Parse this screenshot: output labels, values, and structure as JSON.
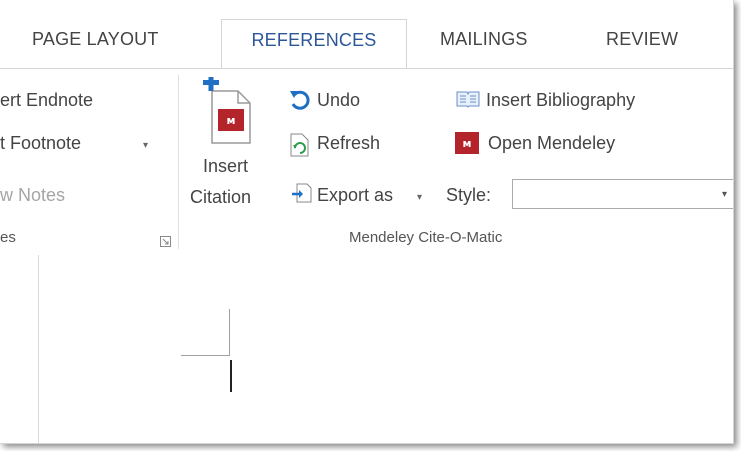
{
  "tabs": [
    {
      "label": "PAGE LAYOUT",
      "active": false
    },
    {
      "label": "REFERENCES",
      "active": true
    },
    {
      "label": "MAILINGS",
      "active": false
    },
    {
      "label": "REVIEW",
      "active": false
    }
  ],
  "footnotes_group": {
    "insert_endnote": "ert Endnote",
    "insert_footnote": "t Footnote",
    "show_notes": "w Notes",
    "label": "es"
  },
  "mendeley": {
    "insert_citation_line1": "Insert",
    "insert_citation_line2": "Citation",
    "undo": "Undo",
    "refresh": "Refresh",
    "export_as": "Export as",
    "style_label": "Style:",
    "style_value": "",
    "insert_bibliography": "Insert Bibliography",
    "open_mendeley": "Open Mendeley",
    "group_label": "Mendeley Cite-O-Matic"
  },
  "colors": {
    "accent": "#2b579a",
    "mendeley_red": "#b3252a",
    "undo_blue": "#1f6fc5"
  }
}
